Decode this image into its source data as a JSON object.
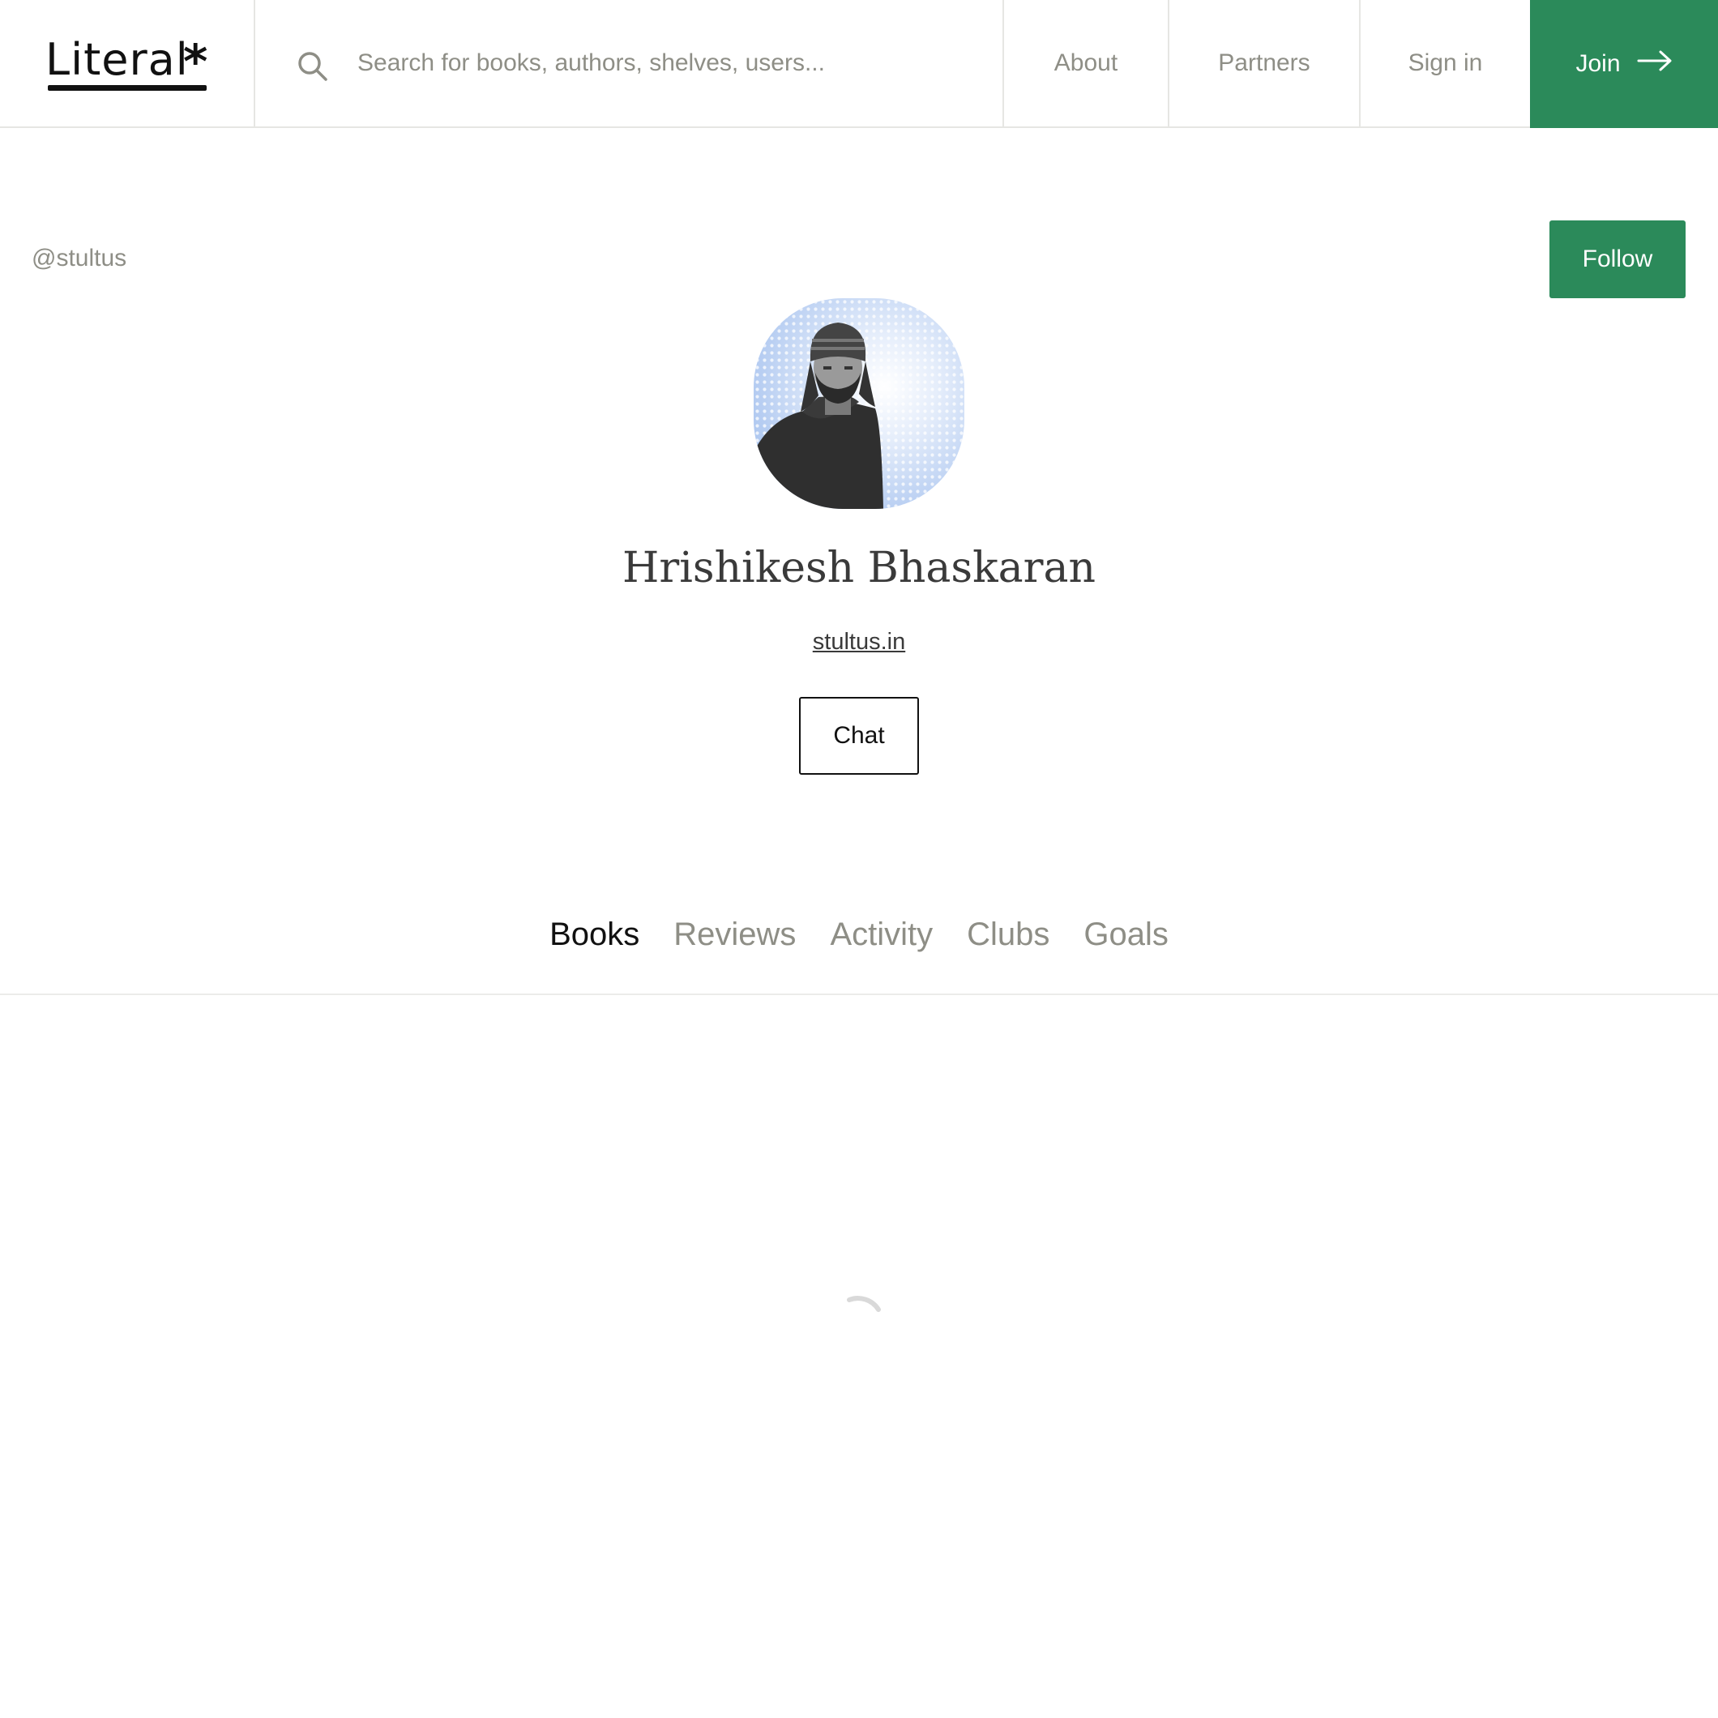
{
  "header": {
    "logo_text": "Literal",
    "logo_mark": "*",
    "search": {
      "placeholder": "Search for books, authors, shelves, users...",
      "value": "",
      "icon": "search-icon"
    },
    "nav": [
      {
        "label": "About"
      },
      {
        "label": "Partners"
      },
      {
        "label": "Sign in"
      }
    ],
    "join_label": "Join",
    "join_icon": "arrow-right-icon"
  },
  "profile": {
    "username": "@stultus",
    "follow_label": "Follow",
    "name": "Hrishikesh Bhaskaran",
    "website": "stultus.in",
    "chat_label": "Chat"
  },
  "tabs": [
    {
      "label": "Books",
      "active": true
    },
    {
      "label": "Reviews",
      "active": false
    },
    {
      "label": "Activity",
      "active": false
    },
    {
      "label": "Clubs",
      "active": false
    },
    {
      "label": "Goals",
      "active": false
    }
  ],
  "content": {
    "loading_icon": "loading-spinner-icon"
  },
  "colors": {
    "brand_green": "#2b8a5a",
    "muted_text": "#8e8e86",
    "border": "#e6e6e3"
  }
}
